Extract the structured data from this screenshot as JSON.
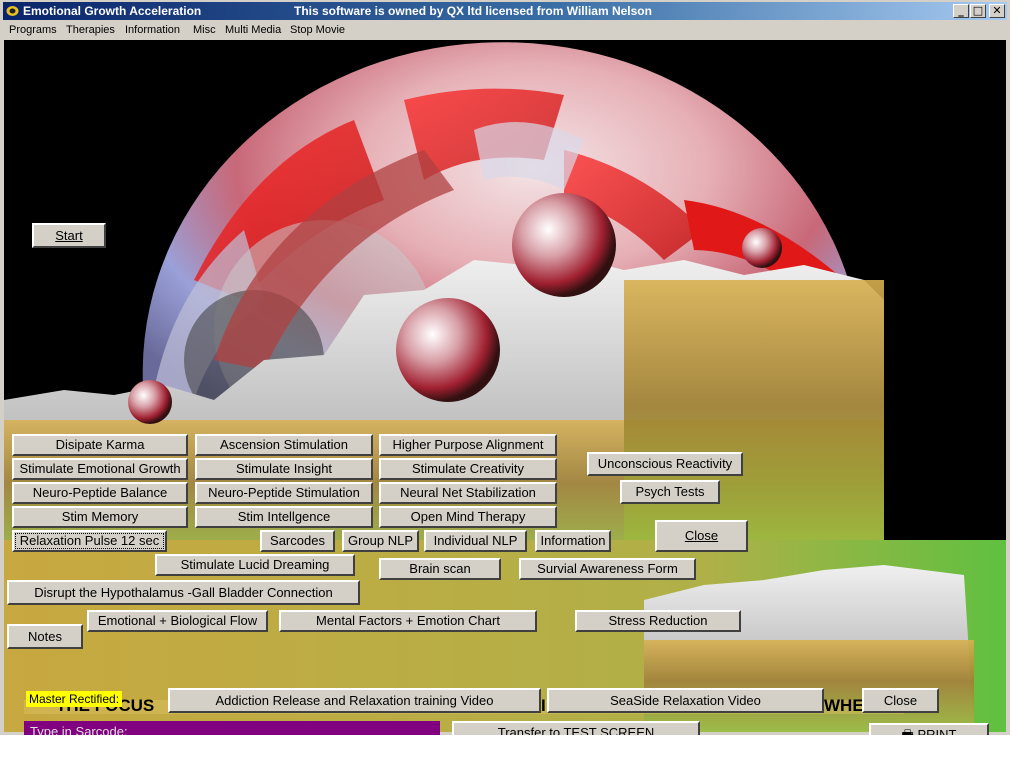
{
  "window": {
    "title": "Emotional Growth Acceleration",
    "owner_text": "This software is owned by QX ltd licensed from William Nelson",
    "controls": {
      "minimize": "_",
      "maximize": "□",
      "close": "✕"
    }
  },
  "menu": [
    "Programs",
    "Therapies",
    "Information",
    "Misc",
    "Multi Media",
    "Stop Movie"
  ],
  "buttons": {
    "start": "Start",
    "dispate_karma": "Disipate Karma",
    "ascension": "Ascension Stimulation",
    "higher_purpose": "Higher Purpose Alignment",
    "emotional_growth": "Stimulate Emotional Growth",
    "insight": "Stimulate Insight",
    "creativity": "Stimulate Creativity",
    "unconscious": "Unconscious Reactivity",
    "np_balance": "Neuro-Peptide Balance",
    "np_stimulation": "Neuro-Peptide Stimulation",
    "neural_net": "Neural Net Stabilization",
    "psych_tests": "Psych Tests",
    "stim_memory": "Stim Memory",
    "stim_intelligence": "Stim Intellgence",
    "open_mind": "Open Mind Therapy",
    "close_upper": "Close",
    "relaxation_pulse": "Relaxation Pulse 12 sec",
    "sarcodes": "Sarcodes",
    "group_nlp": "Group NLP",
    "individual_nlp": "Individual NLP",
    "information": "Information",
    "lucid_dreaming": "Stimulate Lucid Dreaming",
    "brain_scan": "Brain scan",
    "survival_form": "Survial Awareness Form",
    "hypothalamus": "Disrupt  the Hypothalamus -Gall Bladder Connection",
    "notes": "Notes",
    "bio_flow": "Emotional + Biological Flow",
    "mental_factors": "Mental Factors + Emotion Chart",
    "stress_reduction": "Stress Reduction",
    "addiction_video": "Addiction Release and Relaxation training Video",
    "seaside_video": "SeaSide Relaxation Video",
    "close_lower": "Close",
    "transfer": "Transfer to TEST SCREEN",
    "print": "PRINT"
  },
  "status": {
    "master_label": "Master Rectified:",
    "focus_text_left": "THE FOCUS",
    "focus_text_mid": "I",
    "focus_text_right": "WHE",
    "sarcode_input_placeholder": "Type in Sarcode:"
  },
  "colors": {
    "titlebar_start": "#0a246a",
    "canvas_bg": "#000000",
    "button_face": "#d4d0c8",
    "master_label_bg": "#ffff00",
    "sarcode_input_bg": "#800080"
  }
}
